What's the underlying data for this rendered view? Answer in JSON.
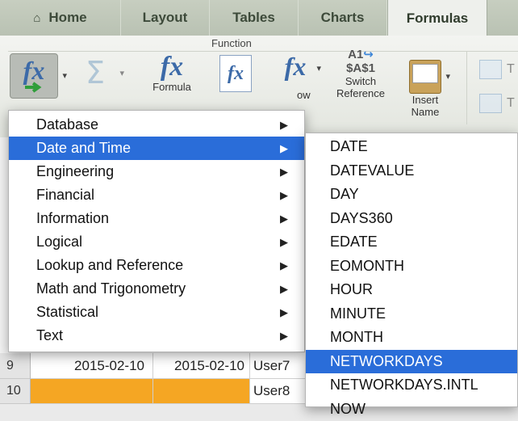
{
  "tabs": [
    "Home",
    "Layout",
    "Tables",
    "Charts",
    "Formulas"
  ],
  "ribbon": {
    "group_label": "Function",
    "formula_builder_label": "Formula",
    "show_label": "ow",
    "switch_reference_line1": "Switch",
    "switch_reference_line2": "Reference",
    "switch_icon_a1": "A1",
    "switch_icon_abs": "$A$1",
    "insert_name_line1": "Insert",
    "insert_name_line2": "Name",
    "right_letter_1": "T",
    "right_letter_2": "T"
  },
  "category_menu": [
    {
      "label": "Database",
      "selected": false
    },
    {
      "label": "Date and Time",
      "selected": true
    },
    {
      "label": "Engineering",
      "selected": false
    },
    {
      "label": "Financial",
      "selected": false
    },
    {
      "label": "Information",
      "selected": false
    },
    {
      "label": "Logical",
      "selected": false
    },
    {
      "label": "Lookup and Reference",
      "selected": false
    },
    {
      "label": "Math and Trigonometry",
      "selected": false
    },
    {
      "label": "Statistical",
      "selected": false
    },
    {
      "label": "Text",
      "selected": false
    }
  ],
  "function_menu": [
    {
      "label": "DATE",
      "selected": false
    },
    {
      "label": "DATEVALUE",
      "selected": false
    },
    {
      "label": "DAY",
      "selected": false
    },
    {
      "label": "DAYS360",
      "selected": false
    },
    {
      "label": "EDATE",
      "selected": false
    },
    {
      "label": "EOMONTH",
      "selected": false
    },
    {
      "label": "HOUR",
      "selected": false
    },
    {
      "label": "MINUTE",
      "selected": false
    },
    {
      "label": "MONTH",
      "selected": false
    },
    {
      "label": "NETWORKDAYS",
      "selected": true
    },
    {
      "label": "NETWORKDAYS.INTL",
      "selected": false
    },
    {
      "label": "NOW",
      "selected": false
    }
  ],
  "sheet_rows": [
    {
      "row": "9",
      "a": "2015-02-10",
      "b": "2015-02-10",
      "c": "User7"
    },
    {
      "row": "10",
      "a": "",
      "b": "",
      "c": "User8"
    }
  ],
  "colors": {
    "selection": "#2a6dd9",
    "row10_fill": "#f5a623",
    "fx_blue": "#3c6aa8",
    "arrow_green": "#2f9e3a"
  },
  "icons": {
    "submenu_arrow": "▶",
    "home": "⌂",
    "dropdown": "▾"
  }
}
